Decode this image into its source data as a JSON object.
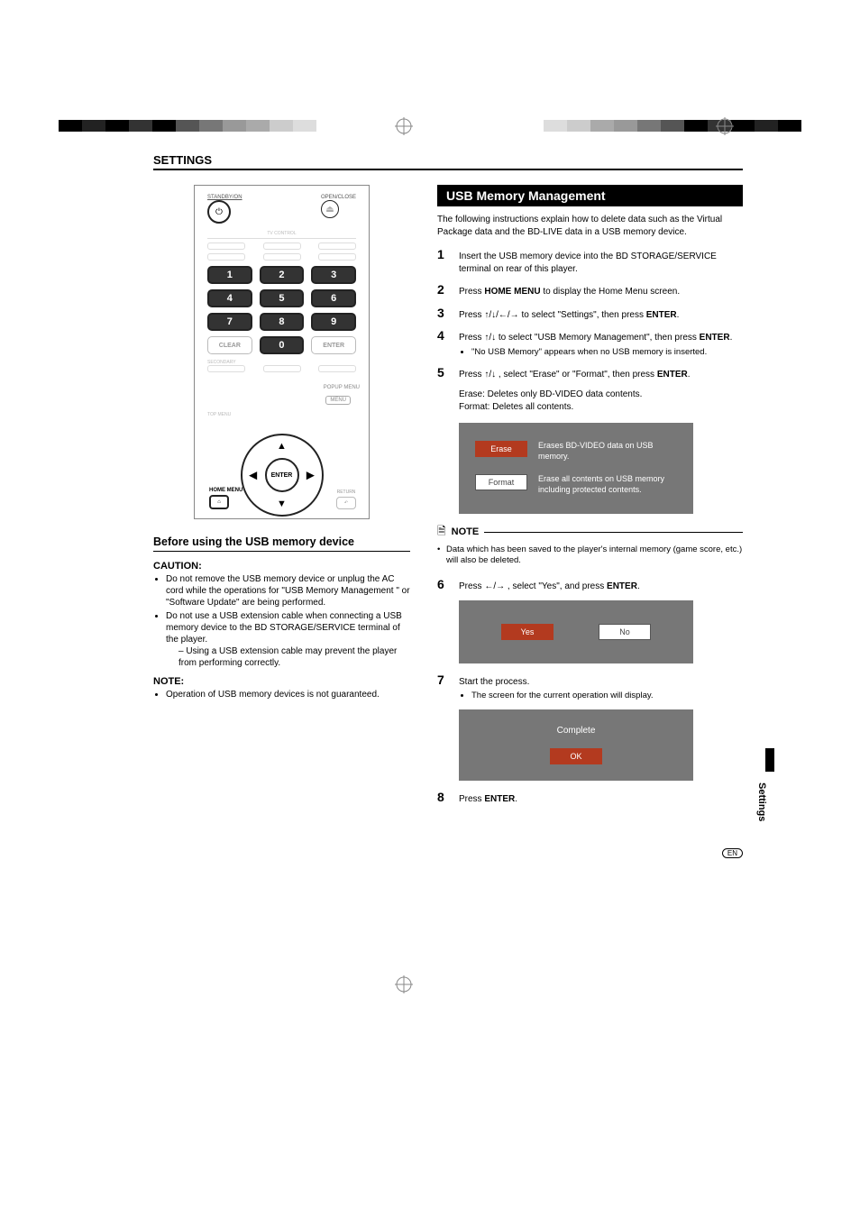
{
  "header": {
    "section": "SETTINGS"
  },
  "remote": {
    "standby": "STANDBY/ON",
    "openclose": "OPEN/CLOSE",
    "tvcontrol": "TV CONTROL",
    "keys": [
      "1",
      "2",
      "3",
      "4",
      "5",
      "6",
      "7",
      "8",
      "9",
      "0"
    ],
    "clear": "CLEAR",
    "enter_small": "ENTER",
    "secondary": "SECONDARY",
    "popup": "POPUP MENU",
    "menu": "MENU",
    "topmenu": "TOP MENU",
    "enter_center": "ENTER",
    "home": "HOME\nMENU",
    "return": "RETURN"
  },
  "left": {
    "subhead": "Before using the USB memory device",
    "caution_head": "CAUTION:",
    "caution_items": [
      "Do not remove the USB memory device or unplug the AC cord while the operations for \"USB Memory Management \" or \"Software Update\" are being performed.",
      "Do not use a USB extension cable when connecting a USB memory device to the BD STORAGE/SERVICE terminal of the player."
    ],
    "caution_sub": "Using a USB extension cable may prevent the player from performing correctly.",
    "note_head": "NOTE:",
    "note_items": [
      "Operation of USB memory devices is not guaranteed."
    ]
  },
  "right": {
    "title": "USB Memory Management",
    "intro": "The following instructions explain how to delete data such as the Virtual Package data and the BD-LIVE data in a USB memory device.",
    "step1": {
      "a": "Insert the USB memory device into the BD STORAGE/SERVICE terminal on rear of this player."
    },
    "step2": {
      "a": "Press ",
      "b": "HOME MENU",
      "c": " to display the Home Menu screen."
    },
    "step3": {
      "a": "Press ",
      "arrows": "↑/↓/←/→",
      "b": " to select \"Settings\", then press ",
      "c": "ENTER",
      "d": "."
    },
    "step4": {
      "a": "Press ",
      "arrows": "↑/↓",
      "b": " to select \"USB Memory Management\", then press ",
      "c": "ENTER",
      "d": ".",
      "sub": "\"No USB Memory\" appears when no USB memory is inserted."
    },
    "step5": {
      "a": "Press ",
      "arrows": "↑/↓",
      "b": " , select \"Erase\" or \"Format\", then press ",
      "c": "ENTER",
      "d": "."
    },
    "erase_format": {
      "erase": "Erase: Deletes only BD-VIDEO data contents.",
      "format": "Format: Deletes all contents."
    },
    "panel1": {
      "erase_btn": "Erase",
      "erase_desc": "Erases BD-VIDEO data on USB memory.",
      "format_btn": "Format",
      "format_desc": "Erase all contents on USB memory including protected contents."
    },
    "note_label": "NOTE",
    "note_body": "Data which has been saved to the player's internal memory (game score, etc.) will also be deleted.",
    "step6": {
      "a": "Press ",
      "arrows": "←/→",
      "b": " , select \"Yes\", and press ",
      "c": "ENTER",
      "d": "."
    },
    "panel2": {
      "yes": "Yes",
      "no": "No"
    },
    "step7": {
      "a": "Start the process.",
      "sub": "The screen for the current operation will display."
    },
    "panel3": {
      "complete": "Complete",
      "ok": "OK"
    },
    "step8": {
      "a": "Press ",
      "b": "ENTER",
      "c": "."
    }
  },
  "side_tab": "Settings",
  "footer": {
    "en": "EN"
  }
}
